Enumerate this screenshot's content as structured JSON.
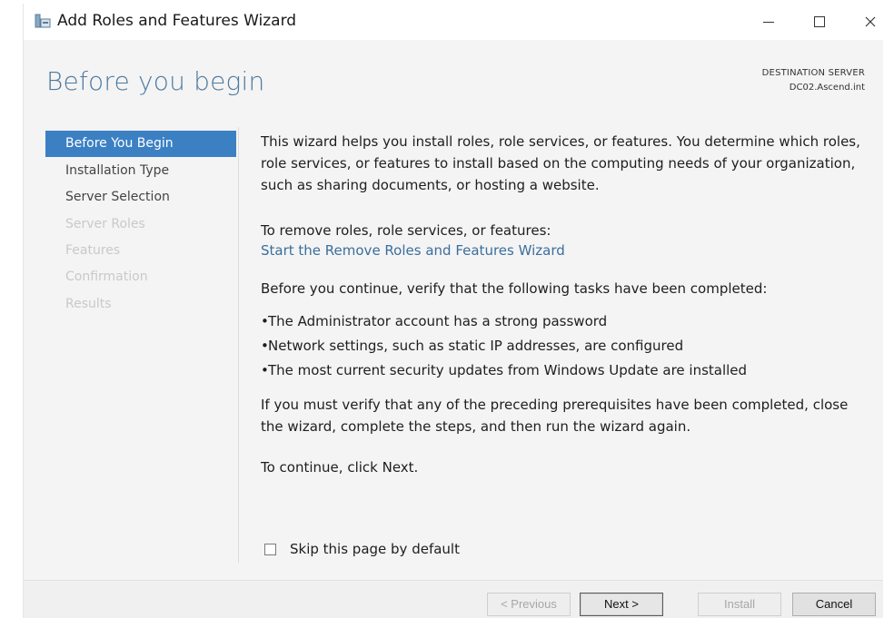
{
  "window": {
    "title": "Add Roles and Features Wizard",
    "minimize_glyph": "–",
    "close_glyph": "✕"
  },
  "header": {
    "heading": "Before you begin",
    "destination_label": "DESTINATION SERVER",
    "destination_value": "DC02.Ascend.int"
  },
  "nav": {
    "items": [
      {
        "label": "Before You Begin",
        "state": "active"
      },
      {
        "label": "Installation Type",
        "state": "enabled"
      },
      {
        "label": "Server Selection",
        "state": "enabled"
      },
      {
        "label": "Server Roles",
        "state": "disabled"
      },
      {
        "label": "Features",
        "state": "disabled"
      },
      {
        "label": "Confirmation",
        "state": "disabled"
      },
      {
        "label": "Results",
        "state": "disabled"
      }
    ]
  },
  "main": {
    "intro": "This wizard helps you install roles, role services, or features. You determine which roles, role services, or features to install based on the computing needs of your organization, such as sharing documents, or hosting a website.",
    "remove_heading": "To remove roles, role services, or features:",
    "remove_link": "Start the Remove Roles and Features Wizard",
    "verify_text": "Before you continue, verify that the following tasks have been completed:",
    "bullets": [
      "The Administrator account has a strong password",
      "Network settings, such as static IP addresses, are configured",
      "The most current security updates from Windows Update are installed"
    ],
    "prereq_text": "If you must verify that any of the preceding prerequisites have been completed, close the wizard, complete the steps, and then run the wizard again.",
    "continue_text": "To continue, click Next.",
    "skip_label": "Skip this page by default",
    "skip_checked": false
  },
  "footer": {
    "previous_label": "< Previous",
    "next_label": "Next >",
    "install_label": "Install",
    "cancel_label": "Cancel"
  },
  "colors": {
    "accent_heading": "#4d7a9f",
    "nav_active": "#3c80c4",
    "link": "#3b6e9c"
  }
}
